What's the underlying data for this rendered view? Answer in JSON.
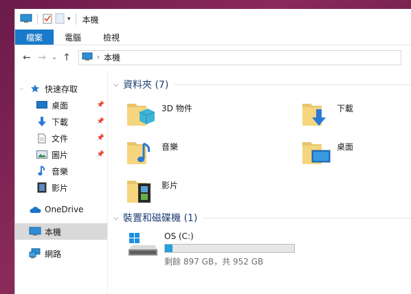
{
  "window": {
    "title": "本機"
  },
  "ribbon": {
    "tabs": [
      {
        "label": "檔案"
      },
      {
        "label": "電腦"
      },
      {
        "label": "檢視"
      }
    ]
  },
  "address": {
    "path": "本機"
  },
  "sidebar": {
    "quick_access": "快速存取",
    "pinned": [
      {
        "label": "桌面",
        "icon": "desktop-icon"
      },
      {
        "label": "下載",
        "icon": "download-icon"
      },
      {
        "label": "文件",
        "icon": "document-icon"
      },
      {
        "label": "圖片",
        "icon": "picture-icon"
      },
      {
        "label": "音樂",
        "icon": "music-icon"
      },
      {
        "label": "影片",
        "icon": "video-icon"
      }
    ],
    "onedrive": "OneDrive",
    "this_pc": "本機",
    "network": "網路"
  },
  "folders_section": {
    "title": "資料夾 (7)"
  },
  "folders": [
    {
      "name": "3D 物件",
      "icon": "3d-objects-icon"
    },
    {
      "name": "下載",
      "icon": "download-icon"
    },
    {
      "name": "音樂",
      "icon": "music-icon"
    },
    {
      "name": "桌面",
      "icon": "desktop-icon"
    },
    {
      "name": "影片",
      "icon": "video-icon"
    }
  ],
  "drives_section": {
    "title": "裝置和磁碟機 (1)"
  },
  "drive": {
    "name": "OS (C:)",
    "space_text": "剩餘 897 GB，共 952 GB",
    "used_fraction": 0.058
  },
  "colors": {
    "accent": "#1979ca",
    "bar_fill": "#26a0da",
    "section_text": "#1e3c72"
  }
}
